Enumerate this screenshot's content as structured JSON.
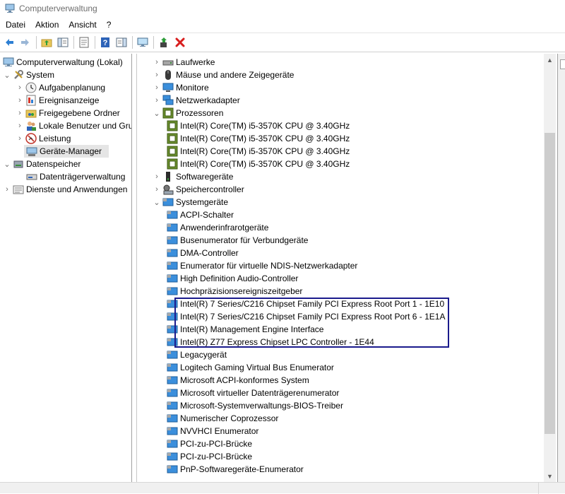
{
  "window": {
    "title": "Computerverwaltung"
  },
  "menu": {
    "items": [
      "Datei",
      "Aktion",
      "Ansicht",
      "?"
    ]
  },
  "toolbar": {
    "buttons": [
      "back-icon",
      "forward-icon",
      "up-folder-icon",
      "show-hide-tree-icon",
      "properties-icon",
      "help-icon",
      "show-action-pane-icon",
      "monitor-icon",
      "update-driver-icon",
      "uninstall-icon"
    ],
    "colors": {
      "back": "#2d7fd3",
      "forward": "#9ab6d6",
      "delete": "#d81e1e",
      "update": "#2e9d3a"
    }
  },
  "left_tree": {
    "root": "Computerverwaltung (Lokal)",
    "system": "System",
    "task_scheduler": "Aufgabenplanung",
    "event_viewer": "Ereignisanzeige",
    "shared_folders": "Freigegebene Ordner",
    "local_users": "Lokale Benutzer und Gruppen",
    "performance": "Leistung",
    "device_manager": "Geräte-Manager",
    "storage": "Datenspeicher",
    "disk_management": "Datenträgerverwaltung",
    "services": "Dienste und Anwendungen"
  },
  "device_tree": {
    "drives": "Laufwerke",
    "mice": "Mäuse und andere Zeigegeräte",
    "monitors": "Monitore",
    "network": "Netzwerkadapter",
    "processors": "Prozessoren",
    "cpu": [
      "Intel(R) Core(TM) i5-3570K CPU @ 3.40GHz",
      "Intel(R) Core(TM) i5-3570K CPU @ 3.40GHz",
      "Intel(R) Core(TM) i5-3570K CPU @ 3.40GHz",
      "Intel(R) Core(TM) i5-3570K CPU @ 3.40GHz"
    ],
    "software_devices": "Softwaregeräte",
    "storage_controllers": "Speichercontroller",
    "system_devices": "Systemgeräte",
    "system_items": [
      "ACPI-Schalter",
      "Anwenderinfrarotgeräte",
      "Busenumerator für Verbundgeräte",
      "DMA-Controller",
      "Enumerator für virtuelle NDIS-Netzwerkadapter",
      "High Definition Audio-Controller",
      "Hochpräzisionsereigniszeitgeber",
      "Intel(R) 7 Series/C216 Chipset Family PCI Express Root Port 1 - 1E10",
      "Intel(R) 7 Series/C216 Chipset Family PCI Express Root Port 6 - 1E1A",
      "Intel(R) Management Engine Interface",
      "Intel(R) Z77 Express Chipset LPC Controller - 1E44",
      "Legacygerät",
      "Logitech Gaming Virtual Bus Enumerator",
      "Microsoft ACPI-konformes System",
      "Microsoft virtueller Datenträgerenumerator",
      "Microsoft-Systemverwaltungs-BIOS-Treiber",
      "Numerischer Coprozessor",
      "NVVHCI Enumerator",
      "PCI-zu-PCI-Brücke",
      "PCI-zu-PCI-Brücke",
      "PnP-Softwaregeräte-Enumerator"
    ]
  },
  "colors": {
    "highlight_border": "#1a1a8c",
    "selection": "#e5e5e5"
  }
}
